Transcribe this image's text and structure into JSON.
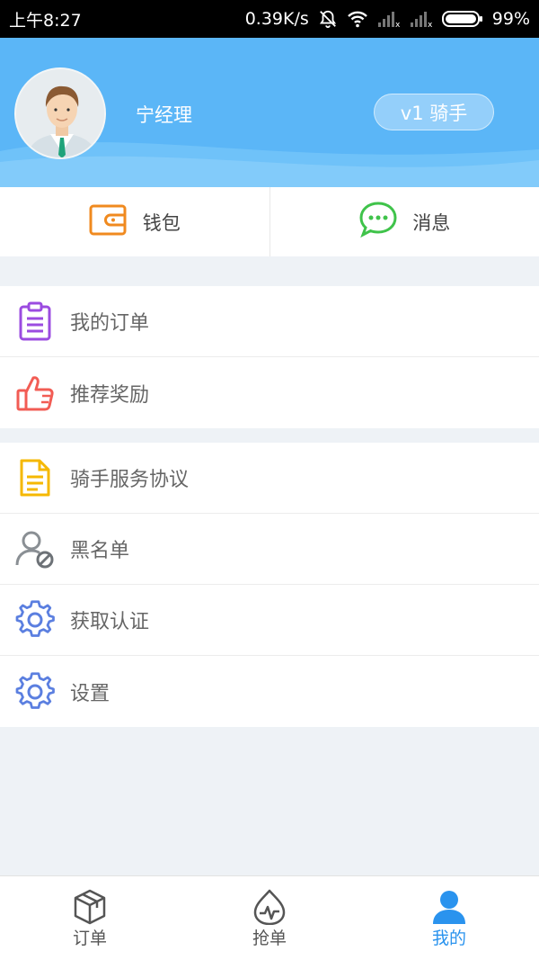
{
  "status_bar": {
    "time": "上午8:27",
    "net_speed": "0.39K/s",
    "battery": "99%"
  },
  "profile": {
    "name": "宁经理",
    "level": "v1 骑手"
  },
  "quick_actions": [
    {
      "label": "钱包",
      "icon": "wallet-icon",
      "color": "#f08a1f"
    },
    {
      "label": "消息",
      "icon": "chat-icon",
      "color": "#3fc34a"
    }
  ],
  "menu_group_1": [
    {
      "label": "我的订单",
      "icon": "clipboard-icon",
      "color": "#9b4be0"
    },
    {
      "label": "推荐奖励",
      "icon": "thumbs-up-icon",
      "color": "#f25c54"
    }
  ],
  "menu_group_2": [
    {
      "label": "骑手服务协议",
      "icon": "document-icon",
      "color": "#f5b800"
    },
    {
      "label": "黑名单",
      "icon": "user-block-icon",
      "color": "#8a8f94"
    },
    {
      "label": "获取认证",
      "icon": "gear-icon",
      "color": "#5b7fe0"
    },
    {
      "label": "设置",
      "icon": "gear-icon",
      "color": "#5b7fe0"
    }
  ],
  "tabs": [
    {
      "label": "订单",
      "icon": "box-icon",
      "active": false
    },
    {
      "label": "抢单",
      "icon": "grab-order-icon",
      "active": false
    },
    {
      "label": "我的",
      "icon": "person-icon",
      "active": true
    }
  ],
  "colors": {
    "header_blue": "#5bb6f7",
    "active_tab": "#2a93ee",
    "page_bg": "#eef2f6"
  }
}
